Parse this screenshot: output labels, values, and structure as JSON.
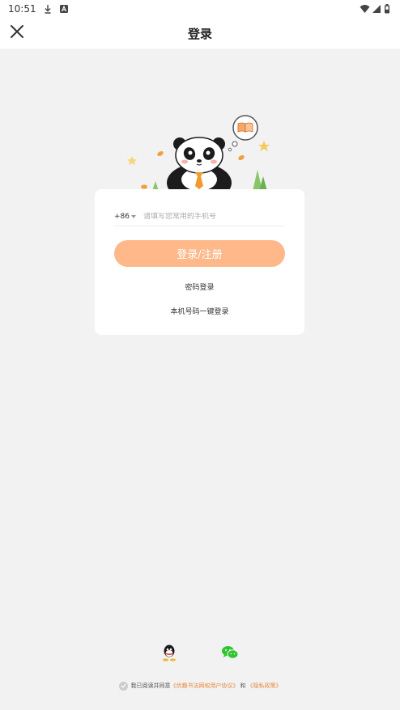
{
  "status_bar": {
    "time": "10:51",
    "icons_left": [
      "download-icon",
      "notification-a-icon"
    ],
    "icons_right": [
      "wifi-icon",
      "signal-icon",
      "battery-icon"
    ]
  },
  "header": {
    "title": "登录",
    "close_icon": "close-icon"
  },
  "login_card": {
    "country_code": "+86",
    "phone_placeholder": "请填写您常用的手机号",
    "phone_value": "",
    "login_button": "登录/注册",
    "password_login": "密码登录",
    "one_click_login": "本机号码一键登录"
  },
  "social_login": {
    "items": [
      "qq-icon",
      "wechat-icon"
    ]
  },
  "agreement": {
    "prefix": "我已阅读并同意",
    "user_agreement": "《优趣书法网权用户协议》",
    "conjunction": "和",
    "privacy_policy": "《隐私政策》",
    "checked": true
  },
  "colors": {
    "accent": "#ffb889",
    "link": "#e8883f",
    "background": "#f2f2f2"
  }
}
